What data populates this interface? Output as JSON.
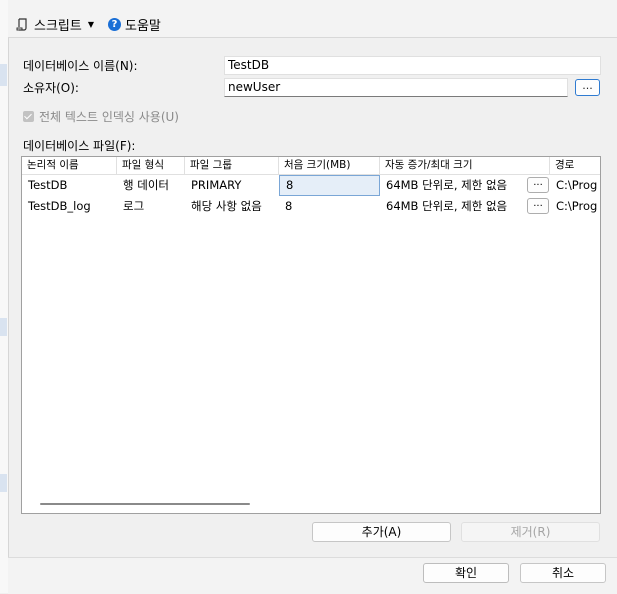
{
  "toolbar": {
    "script_label": "스크립트",
    "help_label": "도움말"
  },
  "form": {
    "db_name_label": "데이터베이스 이름(N):",
    "db_name_value": "TestDB",
    "owner_label": "소유자(O):",
    "owner_value": "newUser",
    "browse_label": "...",
    "fulltext_label": "전체 텍스트 인덱싱 사용(U)",
    "files_label": "데이터베이스 파일(F):"
  },
  "grid": {
    "columns": [
      "논리적 이름",
      "파일 형식",
      "파일 그룹",
      "처음 크기(MB)",
      "자동 증가/최대 크기",
      "경로"
    ],
    "rows": [
      {
        "name": "TestDB",
        "type": "행 데이터",
        "group": "PRIMARY",
        "size": "8",
        "growth": "64MB 단위로, 제한 없음",
        "btn": "...",
        "path": "C:\\Prog"
      },
      {
        "name": "TestDB_log",
        "type": "로그",
        "group": "해당 사항 없음",
        "size": "8",
        "growth": "64MB 단위로, 제한 없음",
        "btn": "...",
        "path": "C:\\Prog"
      }
    ]
  },
  "buttons": {
    "add": "추가(A)",
    "remove": "제거(R)",
    "ok": "확인",
    "cancel": "취소"
  },
  "colors": {
    "accent": "#2f7bd1",
    "help_icon": "#1a6fd6"
  }
}
